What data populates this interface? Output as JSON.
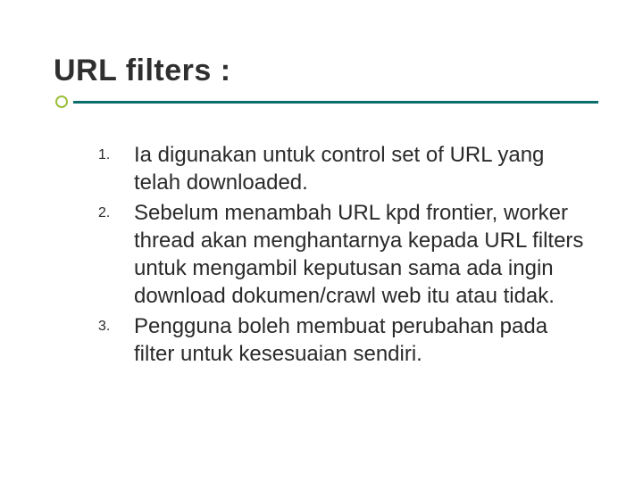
{
  "title": "URL filters :",
  "items": [
    {
      "num": "1.",
      "text": "Ia digunakan untuk control set of URL yang telah downloaded."
    },
    {
      "num": "2.",
      "text": "Sebelum menambah URL kpd frontier, worker thread akan menghantarnya kepada URL filters untuk mengambil keputusan sama ada ingin download dokumen/crawl web itu atau tidak."
    },
    {
      "num": "3.",
      "text": "Pengguna boleh membuat perubahan pada filter untuk kesesuaian sendiri."
    }
  ]
}
